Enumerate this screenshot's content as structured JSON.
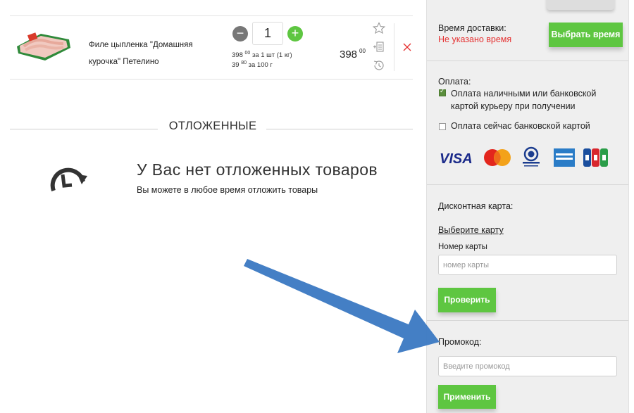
{
  "cart": {
    "product": {
      "name": "Филе цыпленка \"Домашняя курочка\" Петелино",
      "quantity": "1",
      "unit_price_main": "398",
      "unit_price_main_cents": "00",
      "unit_price_main_suffix": "за 1 шт (1 кг)",
      "unit_price_100g": "39",
      "unit_price_100g_cents": "80",
      "unit_price_100g_suffix": "за 100 г",
      "total": "398",
      "total_cents": "00"
    },
    "minus_label": "−",
    "plus_label": "+"
  },
  "postponed": {
    "title": "ОТЛОЖЕННЫЕ",
    "empty_title": "У Вас нет отложенных товаров",
    "empty_subtitle": "Вы можете в любое время отложить товары"
  },
  "checkout": {
    "delivery_time_label": "Время доставки:",
    "delivery_time_value": "Не указано время",
    "choose_time_button": "Выбрать время",
    "payment_label": "Оплата:",
    "payment_options": [
      {
        "label": "Оплата наличными или банковской картой курьеру при получении",
        "checked": true
      },
      {
        "label": "Оплата сейчас банковской картой",
        "checked": false
      }
    ],
    "payment_logos": [
      "visa",
      "mastercard",
      "diners-club",
      "american-express",
      "jcb"
    ],
    "discount_label": "Дисконтная карта:",
    "choose_card_link": "Выберите карту",
    "card_number_label": "Номер карты",
    "card_number_placeholder": "номер карты",
    "check_button": "Проверить",
    "promo_label": "Промокод:",
    "promo_placeholder": "Введите промокод",
    "apply_button": "Применить"
  },
  "colors": {
    "accent_green": "#5ec641",
    "warning_red": "#e53030",
    "arrow_blue": "#3a78c2"
  }
}
